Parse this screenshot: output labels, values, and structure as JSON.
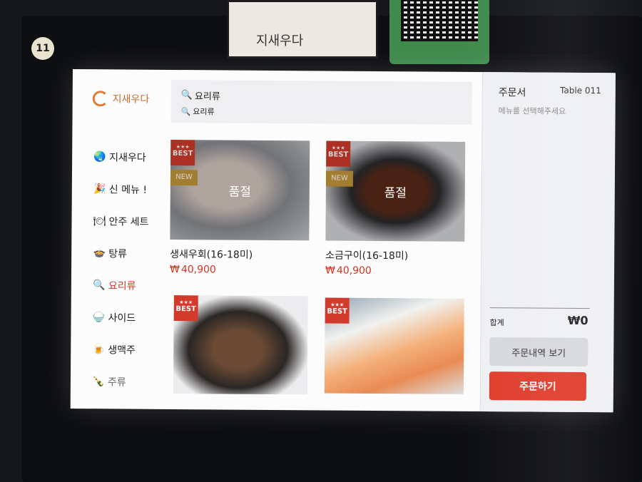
{
  "environment": {
    "table_number_badge": "11",
    "sign_logo": "지새우다"
  },
  "app": {
    "logo_text": "지새우다"
  },
  "search": {
    "line1": "요리류",
    "line2": "요리류"
  },
  "sidebar": {
    "items": [
      {
        "label": "지새우다",
        "icon": "globe-icon",
        "glyph": "🌏"
      },
      {
        "label": "신 메뉴 !",
        "icon": "party-icon",
        "glyph": "🎉"
      },
      {
        "label": "안주 세트",
        "icon": "plate-icon",
        "glyph": "🍽"
      },
      {
        "label": "탕류",
        "icon": "pot-icon",
        "glyph": "🍲"
      },
      {
        "label": "요리류",
        "icon": "search-icon",
        "glyph": "🔍"
      },
      {
        "label": "사이드",
        "icon": "bowl-icon",
        "glyph": "🍚"
      },
      {
        "label": "생맥주",
        "icon": "beer-icon",
        "glyph": "🍺"
      },
      {
        "label": "주류",
        "icon": "bottle-icon",
        "glyph": "🍾"
      }
    ],
    "active_index": 4
  },
  "menu": {
    "best_stars": "★★★",
    "best_label": "BEST",
    "new_label": "NEW",
    "soldout_label": "품절",
    "currency": "₩",
    "items": [
      {
        "name": "생새우회(16-18미)",
        "price": "40,900"
      },
      {
        "name": "소금구이(16-18미)",
        "price": "40,900"
      }
    ]
  },
  "order": {
    "title": "주문서",
    "table_label": "Table 011",
    "hint": "메뉴를 선택해주세요",
    "total_label": "합계",
    "total_value": "₩0",
    "history_button": "주문내역 보기",
    "order_button": "주문하기"
  },
  "colors": {
    "accent": "#e03d2d",
    "best_badge": "#d23b2b",
    "new_badge": "#c79a3c",
    "logo": "#d06a2a"
  }
}
